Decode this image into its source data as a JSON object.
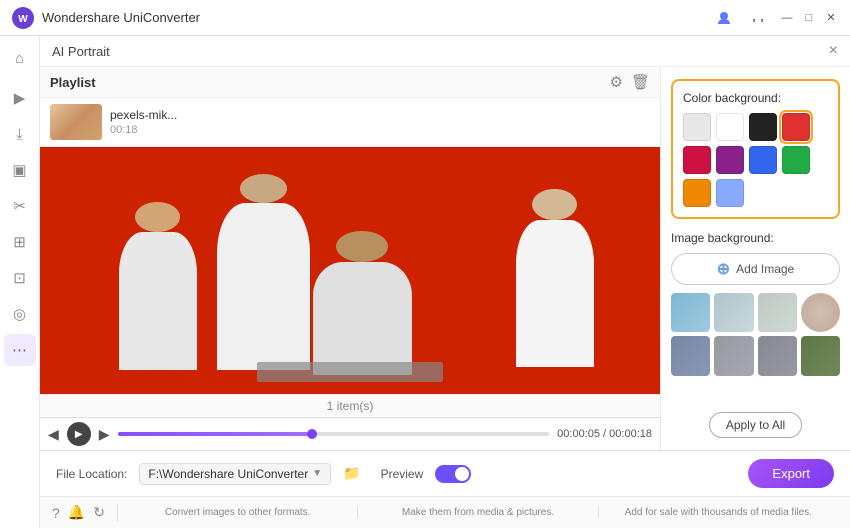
{
  "app": {
    "title": "Wondershare UniConverter",
    "logo_symbol": "W"
  },
  "title_bar": {
    "title": "Wondershare UniConverter",
    "controls": [
      "minimize",
      "maximize",
      "close"
    ]
  },
  "sidebar": {
    "items": [
      {
        "id": "home",
        "icon": "⌂",
        "label": "Home"
      },
      {
        "id": "media",
        "icon": "▶",
        "label": "Media"
      },
      {
        "id": "download",
        "icon": "⤓",
        "label": "Download"
      },
      {
        "id": "screen",
        "icon": "▣",
        "label": "Screen"
      },
      {
        "id": "cut",
        "icon": "✂",
        "label": "Cut"
      },
      {
        "id": "merge",
        "icon": "⊞",
        "label": "Merge"
      },
      {
        "id": "compress",
        "icon": "⊡",
        "label": "Compress"
      },
      {
        "id": "settings",
        "icon": "◎",
        "label": "Settings"
      },
      {
        "id": "more",
        "icon": "⋯",
        "label": "More",
        "active": true
      }
    ]
  },
  "panel": {
    "title": "AI Portrait",
    "close_label": "×"
  },
  "playlist": {
    "title": "Playlist",
    "items_count": "1 item(s)",
    "items": [
      {
        "name": "pexels-mik...",
        "duration": "00:18"
      }
    ]
  },
  "video_controls": {
    "prev_icon": "◀",
    "play_icon": "▶",
    "next_icon": "▶",
    "current_time": "00:00:05",
    "total_time": "00:00:18",
    "progress_percent": 45
  },
  "color_background": {
    "label": "Color background:",
    "swatches": [
      {
        "color": "#e8e8e8",
        "id": "light-gray",
        "selected": false
      },
      {
        "color": "#ffffff",
        "id": "white",
        "selected": false
      },
      {
        "color": "#222222",
        "id": "black",
        "selected": false
      },
      {
        "color": "#e03030",
        "id": "red",
        "selected": true
      },
      {
        "color": "#cc1144",
        "id": "crimson",
        "selected": false
      },
      {
        "color": "#882288",
        "id": "purple",
        "selected": false
      },
      {
        "color": "#3366ee",
        "id": "blue",
        "selected": false
      },
      {
        "color": "#22aa44",
        "id": "green",
        "selected": false
      },
      {
        "color": "#ee8800",
        "id": "orange",
        "selected": false
      },
      {
        "color": "#88aaff",
        "id": "light-blue",
        "selected": false
      }
    ]
  },
  "image_background": {
    "label": "Image background:",
    "add_button_label": "Add Image",
    "thumbnails": [
      {
        "id": "img1",
        "color1": "#7db8d4",
        "color2": "#a0c8e0"
      },
      {
        "id": "img2",
        "color1": "#b0c4cc",
        "color2": "#c8d8dc"
      },
      {
        "id": "img3",
        "color1": "#c0c8c4",
        "color2": "#d0d8d4"
      },
      {
        "id": "img4",
        "color1": "#c8b8a8",
        "color2": "#d8c8b8"
      },
      {
        "id": "img5",
        "color1": "#7888a4",
        "color2": "#8898b4"
      },
      {
        "id": "img6",
        "color1": "#9898a0",
        "color2": "#a8a8b0"
      },
      {
        "id": "img7",
        "color1": "#888890",
        "color2": "#9898a0"
      },
      {
        "id": "img8",
        "color1": "#607848",
        "color2": "#708858"
      }
    ]
  },
  "apply_button": {
    "label": "Apply to All"
  },
  "bottom_bar": {
    "file_location_label": "File Location:",
    "file_path": "F:\\Wondershare UniConverter",
    "preview_label": "Preview",
    "export_label": "Export"
  },
  "info_bar": {
    "items": [
      "Convert images to other formats.",
      "Make them from media & pictures.",
      "Add for sale with thousands of media files."
    ]
  },
  "bottom_icons": [
    {
      "id": "help",
      "icon": "?"
    },
    {
      "id": "bell",
      "icon": "🔔"
    },
    {
      "id": "refresh",
      "icon": "↻"
    }
  ]
}
